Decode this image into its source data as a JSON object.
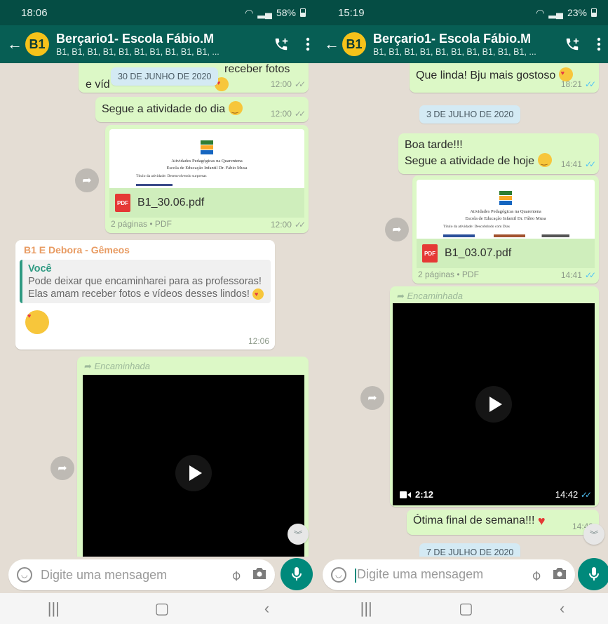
{
  "left": {
    "status": {
      "time": "18:06",
      "battery": "58%"
    },
    "header": {
      "title": "Berçario1- Escola Fábio.M",
      "subtitle": "B1, B1, B1, B1, B1, B1, B1, B1, B1, B1, ..."
    },
    "top_fragment": {
      "line1": "receber fotos",
      "line2_start": "e víd"
    },
    "date_chip": "30 DE JUNHO DE 2020",
    "msg_time_top": "12:00",
    "msg_activity": {
      "text": "Segue a atividade do dia",
      "time": "12:00"
    },
    "doc": {
      "preview_line1": "Atividades Pedagógicas na Quarentena",
      "preview_line2": "Escola de Educação Infantil Dr. Fábio Musa",
      "preview_field": "Título da atividade: Desenvolvendo surpresas",
      "pdf_label": "PDF",
      "filename": "B1_30.06.pdf",
      "footer": "2 páginas • PDF",
      "time": "12:00"
    },
    "reply": {
      "sender": "B1 E Debora - Gêmeos",
      "quoted_author": "Você",
      "quoted_text": "Pode deixar que encaminharei para as professoras! Elas amam receber fotos e vídeos desses lindos!",
      "time": "12:06"
    },
    "forwarded_label": "Encaminhada",
    "input_placeholder": "Digite uma mensagem"
  },
  "right": {
    "status": {
      "time": "15:19",
      "battery": "23%"
    },
    "header": {
      "title": "Berçario1- Escola Fábio.M",
      "subtitle": "B1, B1, B1, B1, B1, B1, B1, B1, B1, B1, ..."
    },
    "msg_top": {
      "text": "Que linda! Bju mais gostoso",
      "time": "18:21"
    },
    "date_chip": "3 DE JULHO DE 2020",
    "msg_greeting": {
      "line1": "Boa tarde!!!",
      "line2": "Segue a atividade de hoje",
      "time": "14:41"
    },
    "doc": {
      "preview_line1": "Atividades Pedagógicas na Quarentena",
      "preview_line2": "Escola de Educação Infantil Dr. Fábio Musa",
      "preview_field": "Título da atividade: Descobrindo com Dias",
      "pdf_label": "PDF",
      "filename": "B1_03.07.pdf",
      "footer": "2 páginas • PDF",
      "time": "14:41"
    },
    "forwarded_label": "Encaminhada",
    "video": {
      "duration": "2:12",
      "time": "14:42"
    },
    "msg_weekend": {
      "text": "Ótima final de semana!!!",
      "time": "14:43"
    },
    "date_chip_2": "7 DE JULHO DE 2020",
    "input_placeholder": "Digite uma mensagem"
  },
  "colors": {
    "header": "#075e54",
    "statusbar": "#054d44",
    "outgoing": "#dcf8c6",
    "incoming": "#ffffff",
    "accent": "#00897b"
  },
  "icons": [
    "back-arrow-icon",
    "add-call-icon",
    "more-vert-icon",
    "pdf-icon",
    "forward-icon",
    "play-icon",
    "video-camera-icon",
    "emoji-icon",
    "attach-icon",
    "camera-icon",
    "mic-icon",
    "scroll-down-icon"
  ]
}
